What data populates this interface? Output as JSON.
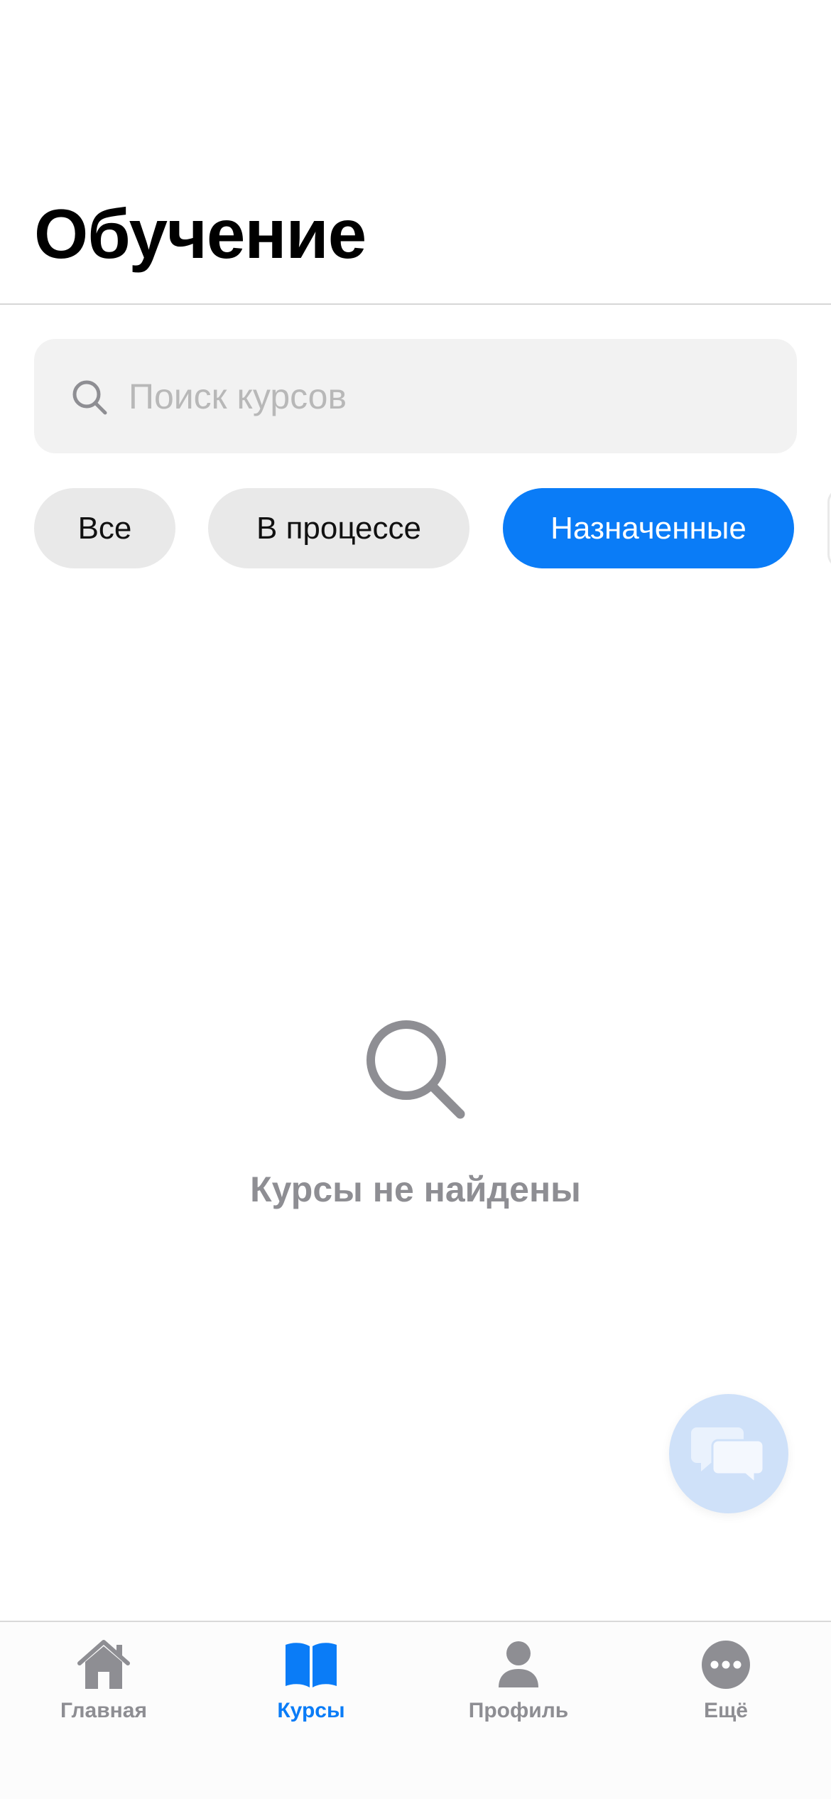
{
  "header": {
    "title": "Обучение"
  },
  "search": {
    "placeholder": "Поиск курсов",
    "value": ""
  },
  "filters": [
    {
      "label": "Все",
      "active": false
    },
    {
      "label": "В процессе",
      "active": false
    },
    {
      "label": "Назначенные",
      "active": true
    }
  ],
  "empty_state": {
    "icon": "search-icon",
    "text": "Курсы не найдены"
  },
  "fab": {
    "icon": "chat-bubbles-icon"
  },
  "tabbar": {
    "items": [
      {
        "label": "Главная",
        "icon": "house-icon",
        "active": false
      },
      {
        "label": "Курсы",
        "icon": "book-icon",
        "active": true
      },
      {
        "label": "Профиль",
        "icon": "person-icon",
        "active": false
      },
      {
        "label": "Ещё",
        "icon": "ellipsis-circle-icon",
        "active": false
      }
    ]
  },
  "colors": {
    "accent": "#0a7cf7",
    "inactive": "#8e8e93",
    "chip_bg": "#e9e9e9",
    "search_bg": "#f2f2f2",
    "fab_bg": "#cfe1f9"
  }
}
